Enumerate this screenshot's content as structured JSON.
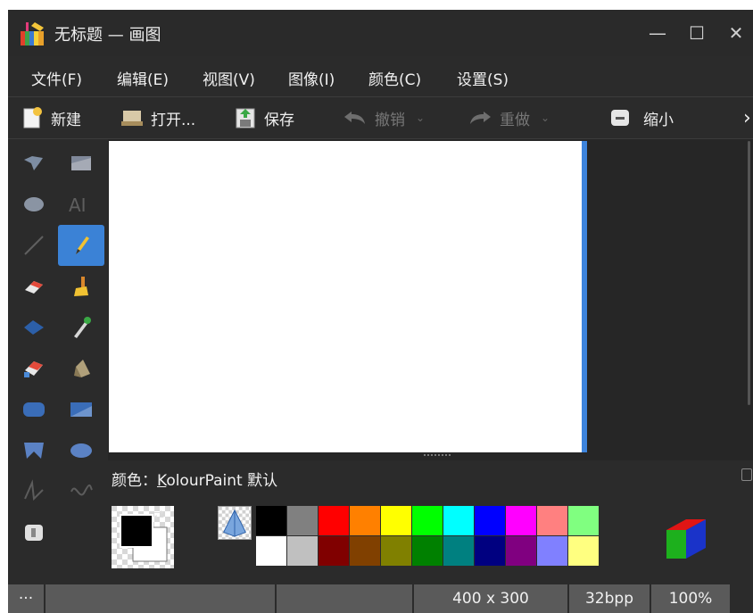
{
  "window": {
    "title": "无标题 — 画图",
    "controls": {
      "minimize": "—",
      "maximize": "☐",
      "close": "✕"
    }
  },
  "menu": [
    "文件(F)",
    "编辑(E)",
    "视图(V)",
    "图像(I)",
    "颜色(C)",
    "设置(S)"
  ],
  "toolbar": {
    "new": "新建",
    "open": "打开...",
    "save": "保存",
    "undo": "撤销",
    "redo": "重做",
    "zoom_out": "缩小",
    "more": "›"
  },
  "tools": [
    "free-form-selection",
    "rectangular-selection",
    "elliptical-selection",
    "text",
    "line",
    "pen",
    "eraser",
    "brush",
    "flood-fill",
    "color-picker",
    "color-eraser",
    "spraycan",
    "rounded-rectangle",
    "rectangle",
    "polygon",
    "ellipse",
    "connected-lines",
    "curve"
  ],
  "tool_selected": "pen",
  "color_box": {
    "label_prefix": "颜色：",
    "label_underlined": "K",
    "label_rest": "olourPaint 默认",
    "foreground": "#000000",
    "background": "#ffffff",
    "palette_row1": [
      "#000000",
      "#808080",
      "#ff0000",
      "#ff8000",
      "#ffff00",
      "#00ff00",
      "#00ffff",
      "#0000ff",
      "#ff00ff",
      "#ff8080",
      "#80ff80"
    ],
    "palette_row2": [
      "#ffffff",
      "#c0c0c0",
      "#800000",
      "#804000",
      "#808000",
      "#008000",
      "#008080",
      "#000080",
      "#800080",
      "#8080ff",
      "#ffff80"
    ]
  },
  "status": {
    "dots": "···",
    "size": "400 x 300",
    "depth": "32bpp",
    "zoom": "100%"
  },
  "colors": {
    "accent": "#3b82d6",
    "bg": "#2b2b2b"
  }
}
